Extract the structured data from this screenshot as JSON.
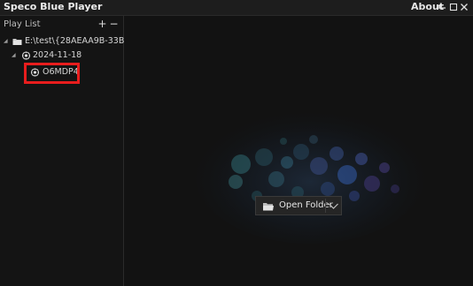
{
  "app": {
    "title": "Speco Blue Player",
    "about_label": "About"
  },
  "window_controls": {
    "dropdown_icon": "chevron-down-icon",
    "maximize_icon": "square-icon",
    "close_icon": "close-icon",
    "dropdown_glyph": "▾",
    "minimize_glyph": "—",
    "maximize_glyph": "□",
    "close_glyph": "✕"
  },
  "sidebar": {
    "title": "Play List",
    "add_glyph": "+",
    "remove_glyph": "−",
    "tree": [
      {
        "level": 0,
        "icon": "folder-icon",
        "label": "E:\\test\\{28AEAA9B-33B7-...",
        "expanded": true
      },
      {
        "level": 1,
        "icon": "camera-icon",
        "label": "2024-11-18",
        "expanded": true
      },
      {
        "level": 2,
        "icon": "camera-icon",
        "label": "O6MDP4",
        "highlighted": true
      }
    ]
  },
  "main": {
    "open_folder_label": "Open Folder",
    "open_folder_icon": "folder-open-icon",
    "dropdown_icon": "chevron-down-icon"
  },
  "colors": {
    "background": "#121212",
    "highlight": "#e81d1d",
    "bokeh_blue": "#3a6bc9"
  }
}
